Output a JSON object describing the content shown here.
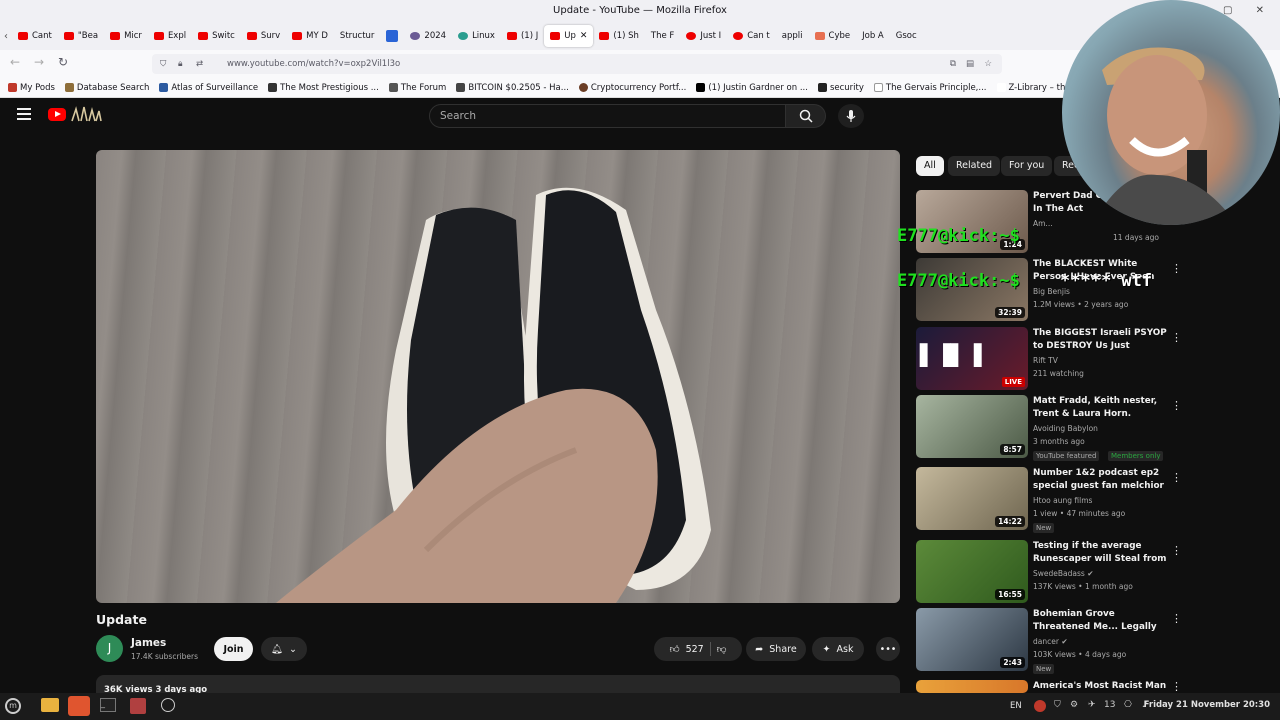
{
  "window": {
    "title": "Update - YouTube — Mozilla Firefox"
  },
  "tabs": [
    {
      "label": "Cant"
    },
    {
      "label": "\"Bea"
    },
    {
      "label": "Micr"
    },
    {
      "label": "Expl"
    },
    {
      "label": "Switc"
    },
    {
      "label": "Surv"
    },
    {
      "label": "MY D"
    },
    {
      "label": "Structur"
    },
    {
      "label": ""
    },
    {
      "label": "2024"
    },
    {
      "label": "Linux"
    },
    {
      "label": "(1) J"
    },
    {
      "label": "Up"
    },
    {
      "label": "(1) Sh"
    },
    {
      "label": "The F"
    },
    {
      "label": "Just I"
    },
    {
      "label": "Can t"
    },
    {
      "label": "appli"
    },
    {
      "label": "Cybe"
    },
    {
      "label": "Job A"
    },
    {
      "label": "Gsoc"
    }
  ],
  "url": "www.youtube.com/watch?v=oxp2Vil1l3o",
  "bookmarks": [
    "My Pods",
    "Database Search",
    "Atlas of Surveillance",
    "The Most Prestigious ...",
    "The Forum",
    "BITCOIN $0.2505 - Ha...",
    "Cryptocurrency Portf...",
    "(1) Justin Gardner on ...",
    "security",
    "The Gervais Principle,...",
    "Z-Library – the world's"
  ],
  "search": {
    "placeholder": "Search"
  },
  "video": {
    "title": "Update",
    "channel": "James",
    "avatar_letter": "J",
    "subscribers": "17.4K subscribers",
    "join": "Join",
    "likes": "527",
    "share": "Share",
    "ask": "Ask",
    "views_date": "36K views  3 days ago"
  },
  "chips": [
    "All",
    "Related",
    "For you",
    "Rec"
  ],
  "recommendations": [
    {
      "title": "Pervert Dad Gets Caught In The Act",
      "channel": "Am...",
      "meta": "11 days ago",
      "duration": "1:24"
    },
    {
      "title": "The BLACKEST White Person I Have Ever Seen",
      "channel": "Big Benjis",
      "meta": "1.2M views • 2 years ago",
      "duration": "32:39"
    },
    {
      "title": "The BIGGEST Israeli PSYOP to DESTROY Us Just DROPPED... ...",
      "channel": "Rift TV",
      "meta": "211 watching",
      "live": "LIVE"
    },
    {
      "title": "Matt Fradd, Keith nester, Trent & Laura Horn.",
      "channel": "Avoiding Babylon",
      "meta": "3 months ago",
      "duration": "8:57",
      "badge": "YouTube featured",
      "badge2": "Members only"
    },
    {
      "title": "Number 1&2 podcast ep2 special guest fan melchior",
      "channel": "Htoo aung films",
      "meta": "1 view • 47 minutes ago",
      "duration": "14:22",
      "badge": "New"
    },
    {
      "title": "Testing if the average Runescaper will Steal from a ...",
      "channel": "SwedeBadass",
      "meta": "137K views • 1 month ago",
      "duration": "16:55"
    },
    {
      "title": "Bohemian Grove Threatened Me... Legally",
      "channel": "dancer",
      "meta": "103K views • 4 days ago",
      "duration": "2:43",
      "badge": "New"
    },
    {
      "title": "America's Most Racist Man tries",
      "channel": "",
      "meta": ""
    }
  ],
  "overlays": {
    "line1": "E777@kick:~$",
    "line2": "E777@kick:~$",
    "wtf": "***** wtf"
  },
  "taskbar": {
    "lang": "EN",
    "tray_count": "13",
    "clock": "Friday 21 November 20:30"
  },
  "colors": {
    "youtube_red": "#ff0000",
    "terminal_green": "#1fe11f",
    "background": "#0f0f0f"
  }
}
